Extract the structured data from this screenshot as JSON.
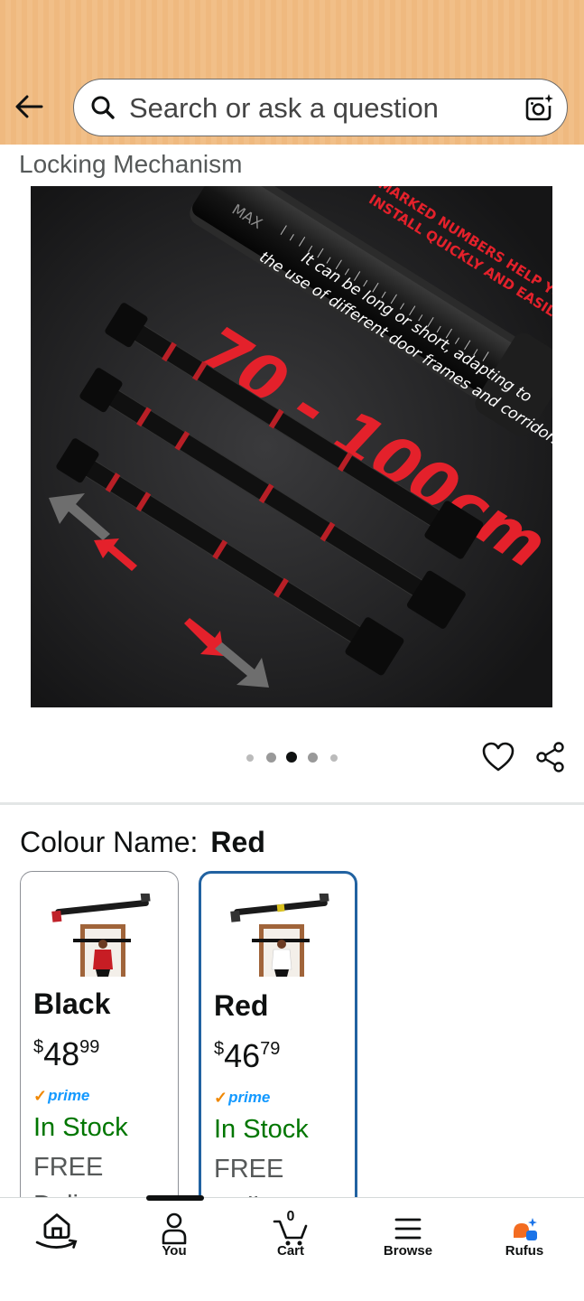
{
  "header": {
    "search_placeholder": "Search or ask a question"
  },
  "section_title": "Locking Mechanism",
  "product_image": {
    "badge_text": "MARKED NUMBERS HELP YOU INSTALL QUICKLY AND EASILY",
    "badge_line1": "MARKED NUMBERS HELP YOU",
    "badge_line2": "INSTALL QUICKLY AND EASILY",
    "range_text": "70 - 100cm",
    "desc_line1": "It can be long or short, adapting to",
    "desc_line2": "the use of different door frames and corridors.",
    "max_label": "MAX",
    "accent_color": "#e4212b"
  },
  "carousel": {
    "total": 5,
    "active_index": 2
  },
  "colour": {
    "label": "Colour Name:",
    "selected": "Red"
  },
  "variants": [
    {
      "name": "Black",
      "currency": "$",
      "price_whole": "48",
      "price_fraction": "99",
      "prime": "prime",
      "stock": "In Stock",
      "shipping": "FREE",
      "delivery": "Delivery",
      "selected": false
    },
    {
      "name": "Red",
      "currency": "$",
      "price_whole": "46",
      "price_fraction": "79",
      "prime": "prime",
      "stock": "In Stock",
      "shipping": "FREE",
      "delivery": "Delivery",
      "selected": true
    }
  ],
  "bottom_nav": {
    "items": [
      {
        "label": "",
        "icon": "home-icon"
      },
      {
        "label": "You",
        "icon": "person-icon"
      },
      {
        "label": "Cart",
        "icon": "cart-icon",
        "count": "0"
      },
      {
        "label": "Browse",
        "icon": "menu-icon"
      },
      {
        "label": "Rufus",
        "icon": "rufus-icon"
      }
    ]
  },
  "colors": {
    "header_bg": "#efb97f",
    "in_stock": "#007600",
    "selected_border": "#2162a1",
    "prime_blue": "#1399ff",
    "prime_check": "#f08804"
  }
}
